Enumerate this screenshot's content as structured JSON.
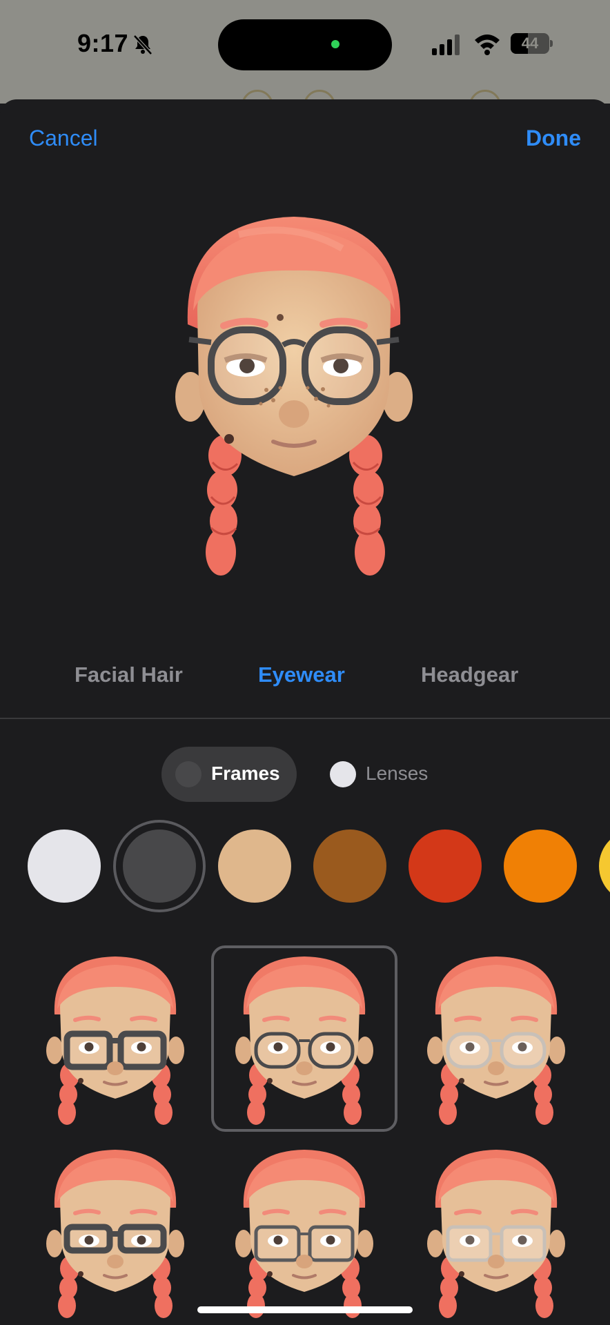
{
  "status_bar": {
    "time": "9:17",
    "battery": "44",
    "battery_level": 0.44
  },
  "nav": {
    "cancel_label": "Cancel",
    "done_label": "Done"
  },
  "category_tabs": [
    {
      "label": "Facial Hair",
      "active": false
    },
    {
      "label": "Eyewear",
      "active": true
    },
    {
      "label": "Headgear",
      "active": false
    }
  ],
  "segment": {
    "frames_label": "Frames",
    "lenses_label": "Lenses",
    "selected": "Frames"
  },
  "frame_colors": [
    "#e5e5ea",
    "#48484a",
    "#dfb78c",
    "#9a5a1e",
    "#d33818",
    "#f08005",
    "#f5c830"
  ],
  "selected_color_index": 1,
  "eyewear_options": [
    {
      "style": "thick-rectangle",
      "frame_color": "#4a4a4c",
      "selected": false
    },
    {
      "style": "round",
      "frame_color": "#4a4a4c",
      "selected": true
    },
    {
      "style": "clear-round",
      "frame_color": "#c8c0b8",
      "selected": false
    },
    {
      "style": "thick-rectangle-low",
      "frame_color": "#4a4a4c",
      "selected": false
    },
    {
      "style": "rectangle-thin",
      "frame_color": "#5a5a5c",
      "selected": false
    },
    {
      "style": "clear-rectangle",
      "frame_color": "#c8c0b8",
      "selected": false
    }
  ],
  "colors": {
    "accent": "#2f8cf7",
    "background": "#1c1c1e",
    "hair": "#ef7a66",
    "skin": "#e6bf98"
  }
}
